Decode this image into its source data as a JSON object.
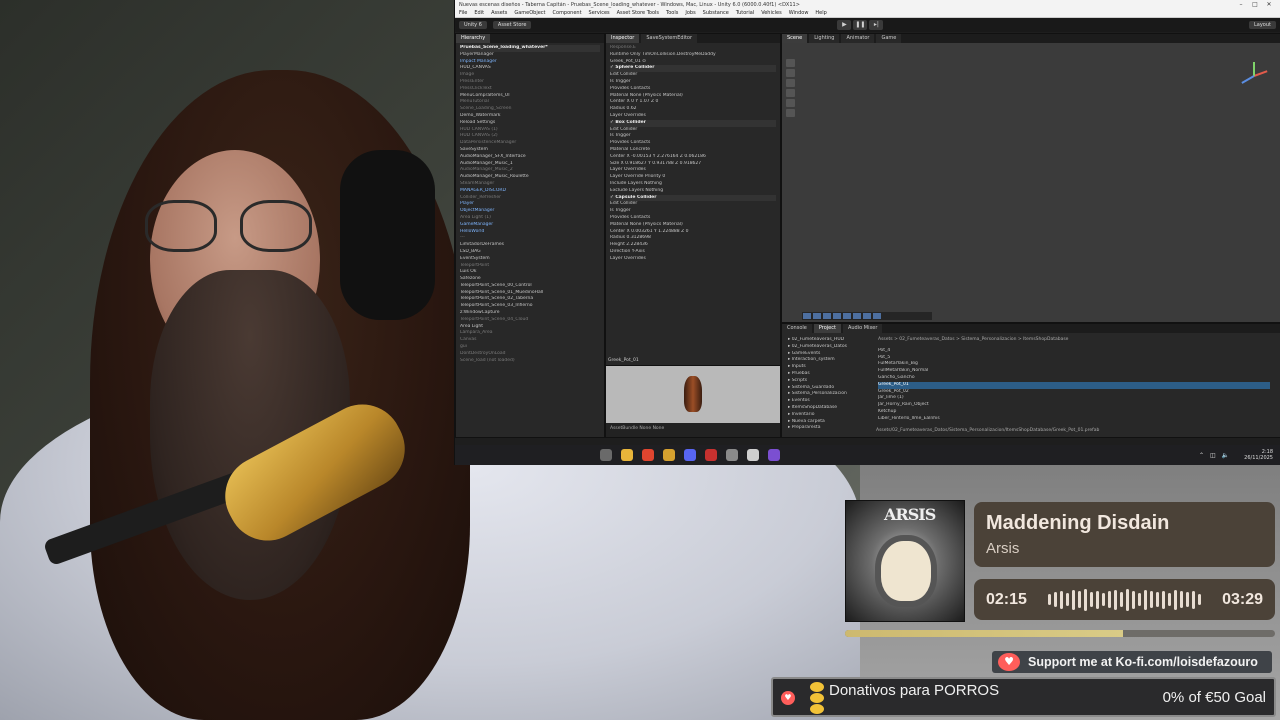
{
  "unity": {
    "window_title": "Nuevas escenas diseños - Taberna Capitán - Pruebas_Scene_loading_whatever - Windows, Mac, Linux - Unity 6.0 (6000.0.40f1) <DX11>",
    "menu": [
      "File",
      "Edit",
      "Assets",
      "GameObject",
      "Component",
      "Services",
      "Asset Store Tools",
      "Tools",
      "Jobs",
      "Substance",
      "Tutorial",
      "Vehicles",
      "Window",
      "Help"
    ],
    "toolbar": {
      "account": "Unity 6",
      "asset_store": "Asset Store",
      "layout": "Layout"
    },
    "hierarchy": {
      "tab": "Hierarchy",
      "rows": [
        {
          "text": "Pruebas_Scene_loading_whatever*",
          "style": "hdr"
        },
        {
          "text": "PlayerManager",
          "style": ""
        },
        {
          "text": "Impact Manager",
          "style": "blue"
        },
        {
          "text": "HUD_CANVAS",
          "style": ""
        },
        {
          "text": "Image",
          "style": "dim"
        },
        {
          "text": "PressEnter",
          "style": "dim"
        },
        {
          "text": "PressClickText",
          "style": "dim"
        },
        {
          "text": "MenuCompraItems_UI",
          "style": ""
        },
        {
          "text": "MenuTutorial",
          "style": "dim"
        },
        {
          "text": "Scene_Loading_Screen",
          "style": "dim"
        },
        {
          "text": "Demo_Watermark",
          "style": ""
        },
        {
          "text": "Reload Settings",
          "style": ""
        },
        {
          "text": "HUD CANVAS (1)",
          "style": "dim"
        },
        {
          "text": "HUD CANVAS (2)",
          "style": "dim"
        },
        {
          "text": "DataPersistenceManager",
          "style": "dim"
        },
        {
          "text": "SaveSystem",
          "style": ""
        },
        {
          "text": "AudioManager_SFX_Interface",
          "style": ""
        },
        {
          "text": "AudioManager_Music_1",
          "style": ""
        },
        {
          "text": "AudioManager_Music_2",
          "style": "dim"
        },
        {
          "text": "AudioManager_Music_Roulette",
          "style": ""
        },
        {
          "text": "SteamManager",
          "style": "dim"
        },
        {
          "text": "MANAGER_DISCORD",
          "style": "blue"
        },
        {
          "text": "Collider_Refresher",
          "style": "dim"
        },
        {
          "text": "Player",
          "style": "blue"
        },
        {
          "text": "ObjectManager",
          "style": "blue"
        },
        {
          "text": "Area Light (1)",
          "style": "dim"
        },
        {
          "text": "GameManager",
          "style": "blue"
        },
        {
          "text": "HelloWorld",
          "style": "blue"
        },
        {
          "text": "---",
          "style": "dim"
        },
        {
          "text": "LimitadorDeFrames",
          "style": ""
        },
        {
          "text": "LSD_BAG",
          "style": ""
        },
        {
          "text": "EventSystem",
          "style": ""
        },
        {
          "text": "TeleportPoint",
          "style": "dim"
        },
        {
          "text": "Luis Ok",
          "style": ""
        },
        {
          "text": "Safezone",
          "style": ""
        },
        {
          "text": "TeleportPoint_Scene_00_Control",
          "style": ""
        },
        {
          "text": "TeleportPoint_Scene_01_MuedinoHall",
          "style": ""
        },
        {
          "text": "TeleportPoint_Scene_02_Taberna",
          "style": ""
        },
        {
          "text": "TeleportPoint_Scene_03_Infierno",
          "style": ""
        },
        {
          "text": "z:WindowCapture",
          "style": ""
        },
        {
          "text": "TeleportPoint_Scene_04_Cloud",
          "style": "dim"
        },
        {
          "text": "Area Light",
          "style": ""
        },
        {
          "text": "Lampara_Area",
          "style": "dim"
        },
        {
          "text": "Canvas",
          "style": "dim"
        },
        {
          "text": "gui",
          "style": "dim"
        },
        {
          "text": "DontDestroyOnLoad",
          "style": "dim"
        },
        {
          "text": "Scene_load (not loaded)",
          "style": "dim"
        }
      ]
    },
    "inspector": {
      "tabs": [
        "Inspector",
        "SaveSystemEditor"
      ],
      "rows": [
        {
          "text": "Response.E",
          "style": "dim"
        },
        {
          "text": "Runtime Only   TimOnCollision.DestroyMeDaddy",
          "style": ""
        },
        {
          "text": "Greek_Pot_01 ⊙",
          "style": ""
        },
        {
          "text": "✓ Sphere Collider",
          "style": "hdr"
        },
        {
          "text": "Edit Collider",
          "style": ""
        },
        {
          "text": "Is Trigger",
          "style": ""
        },
        {
          "text": "Provides Contacts",
          "style": ""
        },
        {
          "text": "Material      None (Physics Material)",
          "style": ""
        },
        {
          "text": "Center     X 0    Y 1.07    Z 0",
          "style": ""
        },
        {
          "text": "Radius     0.62",
          "style": ""
        },
        {
          "text": "Layer Overrides",
          "style": ""
        },
        {
          "text": "✓ Box Collider",
          "style": "hdr"
        },
        {
          "text": "Edit Collider",
          "style": ""
        },
        {
          "text": "Is Trigger",
          "style": ""
        },
        {
          "text": "Provides Contacts",
          "style": ""
        },
        {
          "text": "Material      Concrete",
          "style": ""
        },
        {
          "text": "Center   X -0.00153  Y 2.276164  Z 0.062186",
          "style": ""
        },
        {
          "text": "Size     X 0.918627  Y 0.931788  Z 0.918627",
          "style": ""
        },
        {
          "text": "Layer Overrides",
          "style": ""
        },
        {
          "text": "Layer Override Priority 0",
          "style": ""
        },
        {
          "text": "Include Layers   Nothing",
          "style": ""
        },
        {
          "text": "Exclude Layers   Nothing",
          "style": ""
        },
        {
          "text": "✓ Capsule Collider",
          "style": "hdr"
        },
        {
          "text": "Edit Collider",
          "style": ""
        },
        {
          "text": "Is Trigger",
          "style": ""
        },
        {
          "text": "Provides Contacts",
          "style": ""
        },
        {
          "text": "Material      None (Physics Material)",
          "style": ""
        },
        {
          "text": "Center   X 0.003261  Y 1.224888  Z 0",
          "style": ""
        },
        {
          "text": "Radius     0.3128698",
          "style": ""
        },
        {
          "text": "Height     2.228436",
          "style": ""
        },
        {
          "text": "Direction  Y-Axis",
          "style": ""
        },
        {
          "text": "Layer Overrides",
          "style": ""
        }
      ],
      "preview_label": "Greek_Pot_01",
      "asset_bundle": "AssetBundle   None   None"
    },
    "scene_tabs": [
      "Scene",
      "Lighting",
      "Animator",
      "Game"
    ],
    "project": {
      "tabs": [
        "Console",
        "Project",
        "Audio Mixer"
      ],
      "breadcrumb": "Assets > 02_Fumeteaveras_Datos > Sistema_Personalizacion > ItemsShopDatabase",
      "folders": [
        "02_Fumeteaveras_HUD",
        "02_Fumeteaveras_Datos",
        "GameEvents",
        "Interaction_system",
        "Inputs",
        "Pruebas",
        "Scripts",
        "Sistema_Guardado",
        "Sistema_Personalizacion",
        "Eventos",
        "ItemsShopDatabase",
        "Inventario",
        "Nueva carpeta",
        "Prepararesta"
      ],
      "files": [
        "Pot_4",
        "Pot_5",
        "FulMetalYakin_Big",
        "FullMetalYakin_Normal",
        "Gancho_Gancho",
        "Greek_Pot_01",
        "Greek_Pot_02",
        "Jar_lime (1)",
        "Jar_Horny_Rain_Object",
        "Ketchup",
        "Liber_Hinterlo_Ilme_Ealnhis"
      ],
      "selected_file": "Greek_Pot_01",
      "footer_path": "Assets/02_Fumeteaveras_Datos/Sistema_Personalizacion/ItemsShopDatabase/Greek_Pot_01.prefab"
    },
    "clock": {
      "time": "2:18",
      "date": "26/11/2025"
    }
  },
  "now_playing": {
    "song": "Maddening Disdain",
    "artist": "Arsis",
    "album_art_text": "ARSIS",
    "elapsed": "02:15",
    "duration": "03:29",
    "progress": 0.646,
    "wave_levels": [
      0.4,
      0.6,
      0.8,
      0.5,
      0.9,
      0.7,
      1.0,
      0.6,
      0.8,
      0.5,
      0.7,
      0.9,
      0.6,
      1.0,
      0.8,
      0.5,
      0.9,
      0.7,
      0.6,
      0.8,
      0.5,
      0.9,
      0.7,
      0.6,
      0.8,
      0.4
    ]
  },
  "kofi": {
    "label": "Support me at Ko-fi.com/loisdefazouro"
  },
  "donation_goal": {
    "title": "Donativos para PORROS",
    "status": "0% of €50 Goal"
  },
  "colors": {
    "accent": "#4b4238",
    "kofi_red": "#ff5e5b",
    "progress_fill": "#cdb96f",
    "unity_selection": "#2c5d87"
  }
}
